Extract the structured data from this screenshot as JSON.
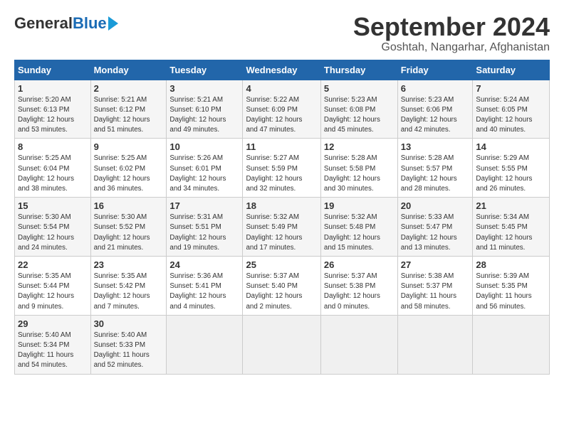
{
  "header": {
    "logo_general": "General",
    "logo_blue": "Blue",
    "title": "September 2024",
    "location": "Goshtah, Nangarhar, Afghanistan"
  },
  "columns": [
    "Sunday",
    "Monday",
    "Tuesday",
    "Wednesday",
    "Thursday",
    "Friday",
    "Saturday"
  ],
  "weeks": [
    [
      {
        "day": "1",
        "lines": [
          "Sunrise: 5:20 AM",
          "Sunset: 6:13 PM",
          "Daylight: 12 hours",
          "and 53 minutes."
        ]
      },
      {
        "day": "2",
        "lines": [
          "Sunrise: 5:21 AM",
          "Sunset: 6:12 PM",
          "Daylight: 12 hours",
          "and 51 minutes."
        ]
      },
      {
        "day": "3",
        "lines": [
          "Sunrise: 5:21 AM",
          "Sunset: 6:10 PM",
          "Daylight: 12 hours",
          "and 49 minutes."
        ]
      },
      {
        "day": "4",
        "lines": [
          "Sunrise: 5:22 AM",
          "Sunset: 6:09 PM",
          "Daylight: 12 hours",
          "and 47 minutes."
        ]
      },
      {
        "day": "5",
        "lines": [
          "Sunrise: 5:23 AM",
          "Sunset: 6:08 PM",
          "Daylight: 12 hours",
          "and 45 minutes."
        ]
      },
      {
        "day": "6",
        "lines": [
          "Sunrise: 5:23 AM",
          "Sunset: 6:06 PM",
          "Daylight: 12 hours",
          "and 42 minutes."
        ]
      },
      {
        "day": "7",
        "lines": [
          "Sunrise: 5:24 AM",
          "Sunset: 6:05 PM",
          "Daylight: 12 hours",
          "and 40 minutes."
        ]
      }
    ],
    [
      {
        "day": "8",
        "lines": [
          "Sunrise: 5:25 AM",
          "Sunset: 6:04 PM",
          "Daylight: 12 hours",
          "and 38 minutes."
        ]
      },
      {
        "day": "9",
        "lines": [
          "Sunrise: 5:25 AM",
          "Sunset: 6:02 PM",
          "Daylight: 12 hours",
          "and 36 minutes."
        ]
      },
      {
        "day": "10",
        "lines": [
          "Sunrise: 5:26 AM",
          "Sunset: 6:01 PM",
          "Daylight: 12 hours",
          "and 34 minutes."
        ]
      },
      {
        "day": "11",
        "lines": [
          "Sunrise: 5:27 AM",
          "Sunset: 5:59 PM",
          "Daylight: 12 hours",
          "and 32 minutes."
        ]
      },
      {
        "day": "12",
        "lines": [
          "Sunrise: 5:28 AM",
          "Sunset: 5:58 PM",
          "Daylight: 12 hours",
          "and 30 minutes."
        ]
      },
      {
        "day": "13",
        "lines": [
          "Sunrise: 5:28 AM",
          "Sunset: 5:57 PM",
          "Daylight: 12 hours",
          "and 28 minutes."
        ]
      },
      {
        "day": "14",
        "lines": [
          "Sunrise: 5:29 AM",
          "Sunset: 5:55 PM",
          "Daylight: 12 hours",
          "and 26 minutes."
        ]
      }
    ],
    [
      {
        "day": "15",
        "lines": [
          "Sunrise: 5:30 AM",
          "Sunset: 5:54 PM",
          "Daylight: 12 hours",
          "and 24 minutes."
        ]
      },
      {
        "day": "16",
        "lines": [
          "Sunrise: 5:30 AM",
          "Sunset: 5:52 PM",
          "Daylight: 12 hours",
          "and 21 minutes."
        ]
      },
      {
        "day": "17",
        "lines": [
          "Sunrise: 5:31 AM",
          "Sunset: 5:51 PM",
          "Daylight: 12 hours",
          "and 19 minutes."
        ]
      },
      {
        "day": "18",
        "lines": [
          "Sunrise: 5:32 AM",
          "Sunset: 5:49 PM",
          "Daylight: 12 hours",
          "and 17 minutes."
        ]
      },
      {
        "day": "19",
        "lines": [
          "Sunrise: 5:32 AM",
          "Sunset: 5:48 PM",
          "Daylight: 12 hours",
          "and 15 minutes."
        ]
      },
      {
        "day": "20",
        "lines": [
          "Sunrise: 5:33 AM",
          "Sunset: 5:47 PM",
          "Daylight: 12 hours",
          "and 13 minutes."
        ]
      },
      {
        "day": "21",
        "lines": [
          "Sunrise: 5:34 AM",
          "Sunset: 5:45 PM",
          "Daylight: 12 hours",
          "and 11 minutes."
        ]
      }
    ],
    [
      {
        "day": "22",
        "lines": [
          "Sunrise: 5:35 AM",
          "Sunset: 5:44 PM",
          "Daylight: 12 hours",
          "and 9 minutes."
        ]
      },
      {
        "day": "23",
        "lines": [
          "Sunrise: 5:35 AM",
          "Sunset: 5:42 PM",
          "Daylight: 12 hours",
          "and 7 minutes."
        ]
      },
      {
        "day": "24",
        "lines": [
          "Sunrise: 5:36 AM",
          "Sunset: 5:41 PM",
          "Daylight: 12 hours",
          "and 4 minutes."
        ]
      },
      {
        "day": "25",
        "lines": [
          "Sunrise: 5:37 AM",
          "Sunset: 5:40 PM",
          "Daylight: 12 hours",
          "and 2 minutes."
        ]
      },
      {
        "day": "26",
        "lines": [
          "Sunrise: 5:37 AM",
          "Sunset: 5:38 PM",
          "Daylight: 12 hours",
          "and 0 minutes."
        ]
      },
      {
        "day": "27",
        "lines": [
          "Sunrise: 5:38 AM",
          "Sunset: 5:37 PM",
          "Daylight: 11 hours",
          "and 58 minutes."
        ]
      },
      {
        "day": "28",
        "lines": [
          "Sunrise: 5:39 AM",
          "Sunset: 5:35 PM",
          "Daylight: 11 hours",
          "and 56 minutes."
        ]
      }
    ],
    [
      {
        "day": "29",
        "lines": [
          "Sunrise: 5:40 AM",
          "Sunset: 5:34 PM",
          "Daylight: 11 hours",
          "and 54 minutes."
        ]
      },
      {
        "day": "30",
        "lines": [
          "Sunrise: 5:40 AM",
          "Sunset: 5:33 PM",
          "Daylight: 11 hours",
          "and 52 minutes."
        ]
      },
      {
        "day": "",
        "lines": []
      },
      {
        "day": "",
        "lines": []
      },
      {
        "day": "",
        "lines": []
      },
      {
        "day": "",
        "lines": []
      },
      {
        "day": "",
        "lines": []
      }
    ]
  ]
}
